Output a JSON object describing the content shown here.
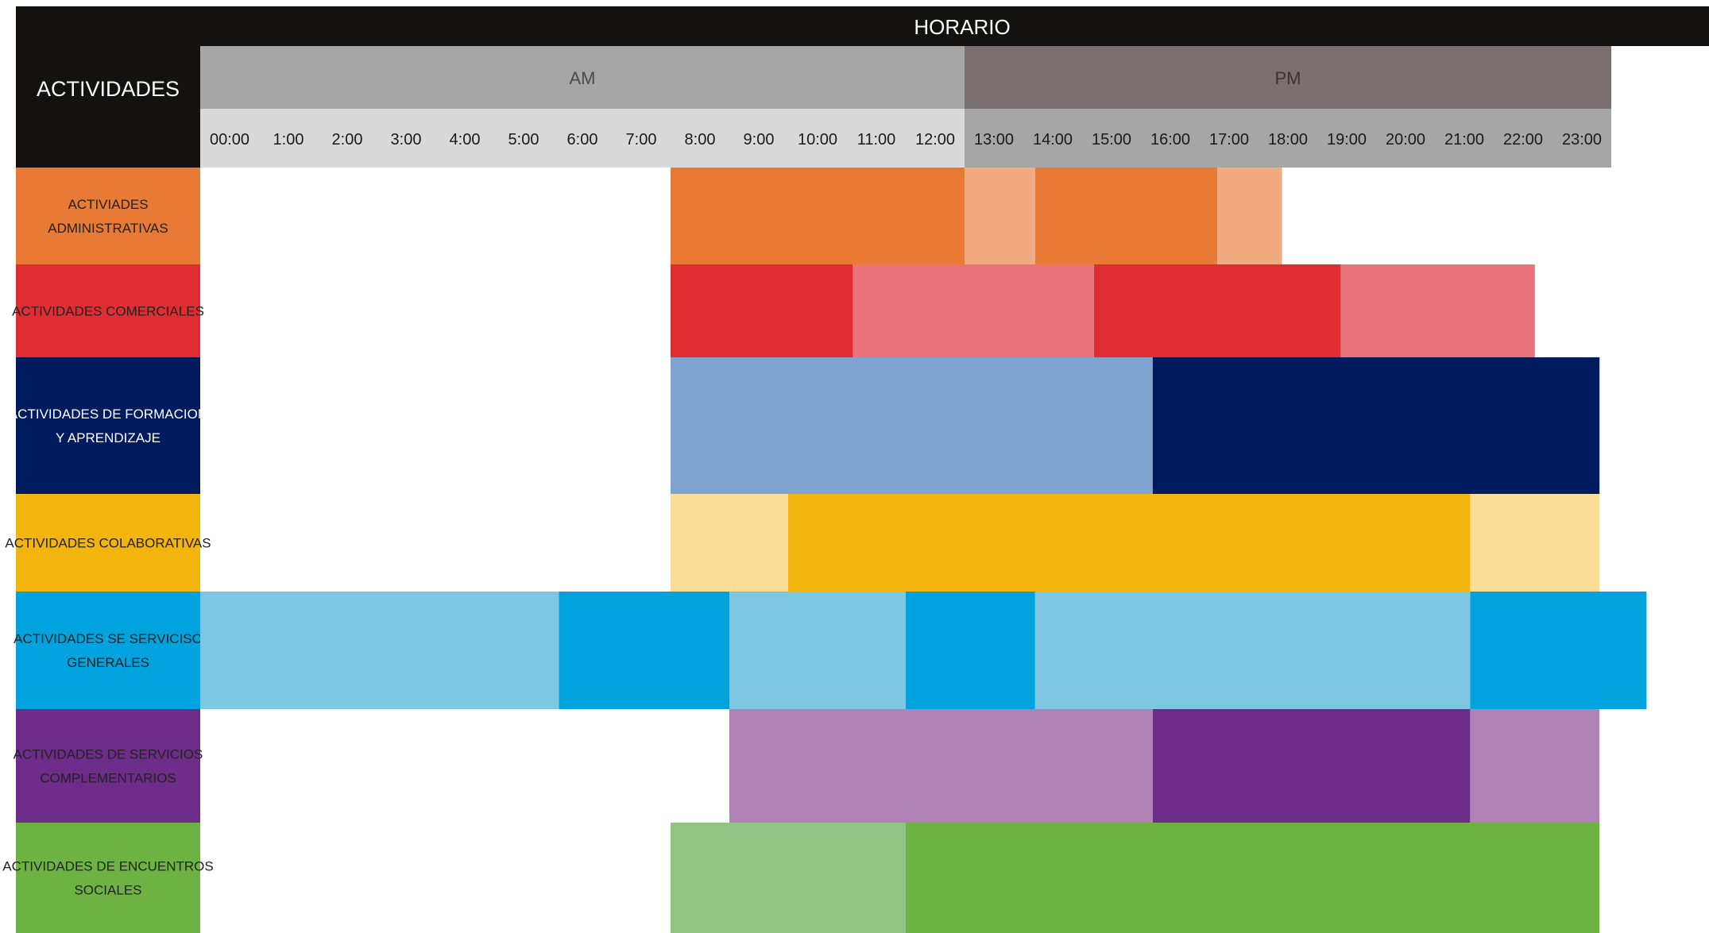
{
  "chart_data": {
    "type": "gantt",
    "title": "HORARIO",
    "activities_header": "ACTIVIDADES",
    "periods": [
      {
        "label": "AM",
        "start": 0,
        "end": 13,
        "band_color": "#a6a6a6",
        "hours_color": "#d9d9d9"
      },
      {
        "label": "PM",
        "start": 13,
        "end": 24,
        "band_color": "#7a7070",
        "hours_color": "#a6a6a6"
      }
    ],
    "hour_labels": [
      "00:00",
      "1:00",
      "2:00",
      "3:00",
      "4:00",
      "5:00",
      "6:00",
      "7:00",
      "8:00",
      "9:00",
      "10:00",
      "11:00",
      "12:00",
      "13:00",
      "14:00",
      "15:00",
      "16:00",
      "17:00",
      "18:00",
      "19:00",
      "20:00",
      "21:00",
      "22:00",
      "23:00"
    ],
    "rows": [
      {
        "label": "ACTIVIADES ADMINISTRATIVAS",
        "label_color": "#e97a35",
        "text_color": "#222222",
        "segments": [
          {
            "start": 8.0,
            "end": 13.0,
            "color": "#e97a35"
          },
          {
            "start": 13.0,
            "end": 14.2,
            "color": "#f2aa80"
          },
          {
            "start": 14.2,
            "end": 17.3,
            "color": "#e97a35"
          },
          {
            "start": 17.3,
            "end": 18.4,
            "color": "#f2aa80"
          }
        ]
      },
      {
        "label": "ACTIVIDADES COMERCIALES",
        "label_color": "#e02d31",
        "text_color": "#222222",
        "segments": [
          {
            "start": 8.0,
            "end": 11.1,
            "color": "#e02d31"
          },
          {
            "start": 11.1,
            "end": 15.2,
            "color": "#e8737a"
          },
          {
            "start": 15.2,
            "end": 19.4,
            "color": "#e02d31"
          },
          {
            "start": 19.4,
            "end": 22.7,
            "color": "#e8737a"
          }
        ]
      },
      {
        "label": "ACTIVIDADES DE FORMACION Y APRENDIZAJE",
        "label_color": "#001b5e",
        "text_color": "#ffffff",
        "segments": [
          {
            "start": 8.0,
            "end": 16.2,
            "color": "#7fa4d1"
          },
          {
            "start": 16.2,
            "end": 23.8,
            "color": "#001b5e"
          }
        ]
      },
      {
        "label": "ACTIVIDADES COLABORATIVAS",
        "label_color": "#f3b40d",
        "text_color": "#222222",
        "segments": [
          {
            "start": 8.0,
            "end": 10.0,
            "color": "#fadd96"
          },
          {
            "start": 10.0,
            "end": 21.6,
            "color": "#f3b40d"
          },
          {
            "start": 21.6,
            "end": 23.8,
            "color": "#fadd96"
          }
        ]
      },
      {
        "label": "ACTIVIDADES SE SERVICISO GENERALES",
        "label_color": "#00a3dd",
        "text_color": "#222222",
        "segments": [
          {
            "start": 0.0,
            "end": 6.1,
            "color": "#7dc7e3"
          },
          {
            "start": 6.1,
            "end": 9.0,
            "color": "#00a3dd"
          },
          {
            "start": 9.0,
            "end": 12.0,
            "color": "#7dc7e3"
          },
          {
            "start": 12.0,
            "end": 14.2,
            "color": "#00a3dd"
          },
          {
            "start": 14.2,
            "end": 21.6,
            "color": "#7dc7e3"
          },
          {
            "start": 21.6,
            "end": 24.6,
            "color": "#00a3dd"
          }
        ]
      },
      {
        "label": "ACTIVIDADES DE SERVICIOS COMPLEMENTARIOS",
        "label_color": "#6e2c8a",
        "text_color": "#222222",
        "segments": [
          {
            "start": 9.0,
            "end": 16.2,
            "color": "#b082b5"
          },
          {
            "start": 16.2,
            "end": 21.6,
            "color": "#6e2c8a"
          },
          {
            "start": 21.6,
            "end": 23.8,
            "color": "#b082b5"
          }
        ]
      },
      {
        "label": "ACTIVIDADES DE ENCUENTROS SOCIALES",
        "label_color": "#6fb244",
        "text_color": "#222222",
        "segments": [
          {
            "start": 8.0,
            "end": 12.0,
            "color": "#92c585"
          },
          {
            "start": 12.0,
            "end": 23.8,
            "color": "#6fb244"
          }
        ]
      }
    ]
  }
}
